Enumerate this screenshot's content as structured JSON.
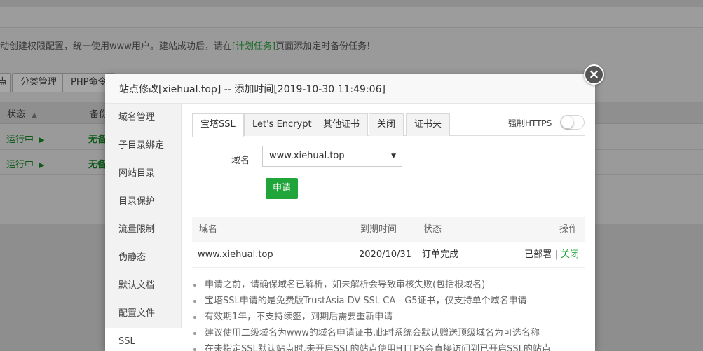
{
  "background": {
    "notice_part1": "动创建权限配置，统一使用www用户。建站成功后，请在",
    "notice_link": "[计划任务]",
    "notice_part2": "页面添加定时备份任务!",
    "buttons": [
      "点",
      "分类管理",
      "PHP命令"
    ],
    "table_headers": [
      "状态",
      "备份"
    ],
    "sort_icon": "▲",
    "rows": [
      {
        "status": "运行中",
        "backup": "无备"
      },
      {
        "status": "运行中",
        "backup": "无备"
      }
    ],
    "play_icon": "▶"
  },
  "modal": {
    "title": "站点修改[xiehual.top] -- 添加时间[2019-10-30 11:49:06]",
    "close_icon": "×",
    "sidebar": [
      {
        "label": "域名管理"
      },
      {
        "label": "子目录绑定"
      },
      {
        "label": "网站目录"
      },
      {
        "label": "目录保护"
      },
      {
        "label": "流量限制"
      },
      {
        "label": "伪静态"
      },
      {
        "label": "默认文档"
      },
      {
        "label": "配置文件"
      },
      {
        "label": "SSL"
      }
    ],
    "tabs": [
      {
        "label": "宝塔SSL"
      },
      {
        "label": "Let's Encrypt"
      },
      {
        "label": "其他证书"
      },
      {
        "label": "关闭"
      },
      {
        "label": "证书夹"
      }
    ],
    "force_https_label": "强制HTTPS",
    "force_https_on": false,
    "domain_label": "域名",
    "domain_value": "www.xiehual.top",
    "select_arrow": "▼",
    "apply_label": "申请",
    "table": {
      "headers": [
        "域名",
        "到期时间",
        "状态",
        "操作"
      ],
      "rows": [
        {
          "domain": "www.xiehual.top",
          "expire": "2020/10/31",
          "status": "订单完成",
          "deployed": "已部署",
          "sep": "|",
          "action": "关闭"
        }
      ]
    },
    "tips": [
      "申请之前，请确保域名已解析，如未解析会导致审核失败(包括根域名)",
      "宝塔SSL申请的是免费版TrustAsia DV SSL CA - G5证书，仅支持单个域名申请",
      "有效期1年，不支持续签，到期后需要重新申请",
      "建议使用二级域名为www的域名申请证书,此时系统会默认赠送顶级域名为可选名称",
      "在未指定SSL默认站点时,未开启SSL的站点使用HTTPS会直接访问到已开启SSL的站点"
    ]
  },
  "colors": {
    "accent_green": "#20a53a",
    "overlay": "#9a9a9a"
  }
}
